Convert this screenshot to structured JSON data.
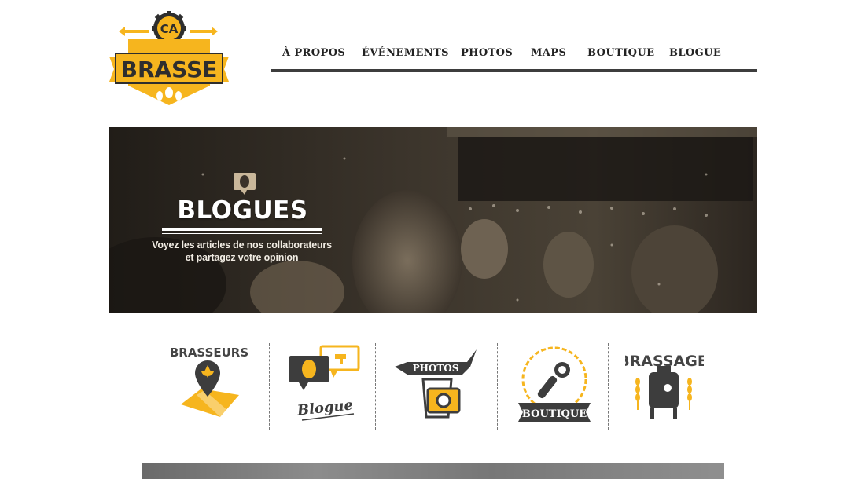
{
  "logo": {
    "badge_text": "CA",
    "brand_text": "BRASSE"
  },
  "nav": {
    "items": [
      {
        "label": "À PROPOS"
      },
      {
        "label": "ÉVÉNEMENTS"
      },
      {
        "label": "PHOTOS"
      },
      {
        "label": "MAPS"
      },
      {
        "label": "BOUTIQUE"
      },
      {
        "label": "BLOGUE"
      }
    ]
  },
  "hero": {
    "title": "BLOGUES",
    "subtitle_line1": "Voyez les articles de nos collaborateurs",
    "subtitle_line2": "et partagez votre opinion"
  },
  "categories": [
    {
      "label": "BRASSEURS",
      "icon": "map-pin-fleur-de-lis-icon"
    },
    {
      "label": "Blogue",
      "icon": "speech-bubbles-icon"
    },
    {
      "label": "PHOTOS",
      "icon": "camera-beer-glass-icon"
    },
    {
      "label": "BOUTIQUE",
      "icon": "bottle-opener-icon"
    },
    {
      "label": "BRASSAGE",
      "icon": "fermenter-tank-icon"
    }
  ],
  "colors": {
    "accent": "#f6b51e",
    "dark": "#333333",
    "nav_rule": "#3d3d3d"
  }
}
